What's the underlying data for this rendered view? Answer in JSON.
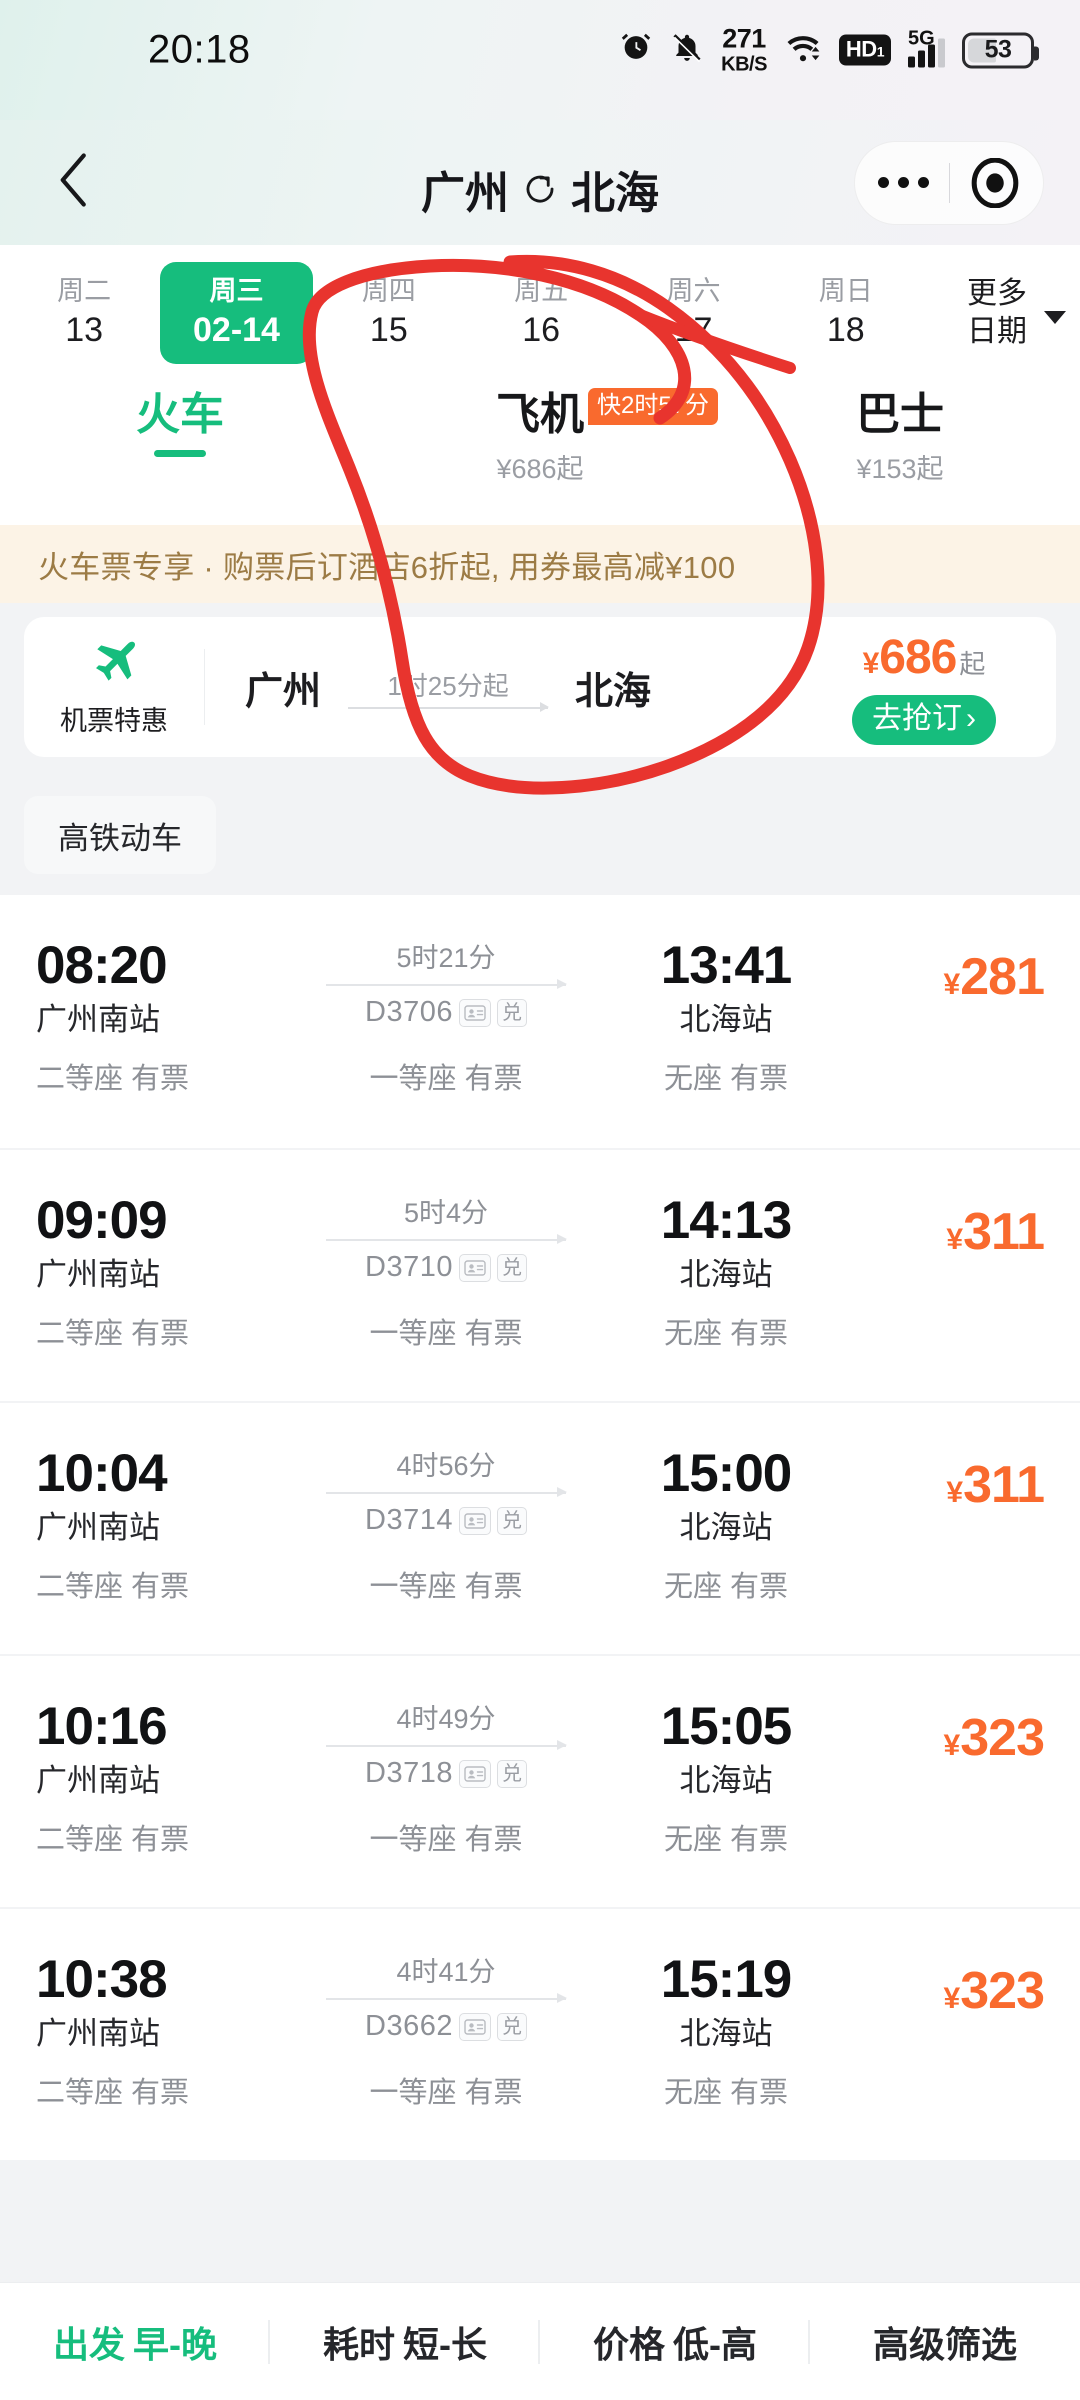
{
  "status_bar": {
    "time": "20:18",
    "alarm_icon": "alarm-icon",
    "mute_icon": "bell-muted-icon",
    "net_speed_value": "271",
    "net_speed_unit": "KB/S",
    "wifi_icon": "wifi-icon",
    "hd_label": "HD",
    "hd_sub": "1",
    "network_type": "5G",
    "battery_level": "53"
  },
  "nav": {
    "back_icon": "back-chevron-icon",
    "origin": "广州",
    "swap_icon": "swap-round-trip-icon",
    "destination": "北海",
    "capsule_more_icon": "more-dots-icon",
    "capsule_target_icon": "mini-program-close-icon"
  },
  "dates": {
    "items": [
      {
        "weekday": "周二",
        "day": "13",
        "active": false
      },
      {
        "weekday": "周三",
        "day": "02-14",
        "active": true
      },
      {
        "weekday": "周四",
        "day": "15",
        "active": false
      },
      {
        "weekday": "周五",
        "day": "16",
        "active": false
      },
      {
        "weekday": "周六",
        "day": "17",
        "active": false
      },
      {
        "weekday": "周日",
        "day": "18",
        "active": false
      }
    ],
    "more_line1": "更多",
    "more_line2": "日期"
  },
  "transport_tabs": [
    {
      "label": "火车",
      "sub": "",
      "badge": "",
      "active": true
    },
    {
      "label": "飞机",
      "sub": "¥686起",
      "badge": "快2时57分",
      "active": false
    },
    {
      "label": "巴士",
      "sub": "¥153起",
      "badge": "",
      "active": false
    }
  ],
  "ribbon": {
    "text": "火车票专享 · 购票后订酒店6折起, 用券最高减¥100"
  },
  "flight_promo": {
    "plane_icon": "airplane-icon",
    "tag": "机票特惠",
    "origin": "广州",
    "duration": "1时25分起",
    "destination": "北海",
    "currency": "¥",
    "price": "686",
    "price_suffix": "起",
    "cta": "去抢订",
    "cta_arrow": "›"
  },
  "filter_chips": [
    {
      "label": "高铁动车"
    }
  ],
  "trains": [
    {
      "depart_time": "08:20",
      "depart_station": "广州南站",
      "duration": "5时21分",
      "train_no": "D3706",
      "badge_id_icon": "id-card-icon",
      "badge_exchange": "兑",
      "arrive_time": "13:41",
      "arrive_station": "北海站",
      "currency": "¥",
      "price": "281",
      "seats": [
        "二等座 有票",
        "一等座 有票",
        "无座 有票"
      ]
    },
    {
      "depart_time": "09:09",
      "depart_station": "广州南站",
      "duration": "5时4分",
      "train_no": "D3710",
      "badge_id_icon": "id-card-icon",
      "badge_exchange": "兑",
      "arrive_time": "14:13",
      "arrive_station": "北海站",
      "currency": "¥",
      "price": "311",
      "seats": [
        "二等座 有票",
        "一等座 有票",
        "无座 有票"
      ]
    },
    {
      "depart_time": "10:04",
      "depart_station": "广州南站",
      "duration": "4时56分",
      "train_no": "D3714",
      "badge_id_icon": "id-card-icon",
      "badge_exchange": "兑",
      "arrive_time": "15:00",
      "arrive_station": "北海站",
      "currency": "¥",
      "price": "311",
      "seats": [
        "二等座 有票",
        "一等座 有票",
        "无座 有票"
      ]
    },
    {
      "depart_time": "10:16",
      "depart_station": "广州南站",
      "duration": "4时49分",
      "train_no": "D3718",
      "badge_id_icon": "id-card-icon",
      "badge_exchange": "兑",
      "arrive_time": "15:05",
      "arrive_station": "北海站",
      "currency": "¥",
      "price": "323",
      "seats": [
        "二等座 有票",
        "一等座 有票",
        "无座 有票"
      ]
    },
    {
      "depart_time": "10:38",
      "depart_station": "广州南站",
      "duration": "4时41分",
      "train_no": "D3662",
      "badge_id_icon": "id-card-icon",
      "badge_exchange": "兑",
      "arrive_time": "15:19",
      "arrive_station": "北海站",
      "currency": "¥",
      "price": "323",
      "seats": [
        "二等座 有票",
        "一等座 有票",
        "无座 有票"
      ]
    }
  ],
  "bottom_bar": [
    {
      "key": "出发",
      "opt": "早-晚",
      "active": true
    },
    {
      "key": "耗时",
      "opt": "短-长",
      "active": false
    },
    {
      "key": "价格",
      "opt": "低-高",
      "active": false
    },
    {
      "key": "高级筛选",
      "opt": "",
      "active": false
    }
  ],
  "annotation": {
    "type": "hand-drawn-circle",
    "color": "#e8342e",
    "target": "飞机"
  },
  "colors": {
    "brand_green": "#16bd7d",
    "price_orange": "#f96a2e",
    "badge_orange": "#f96a2e",
    "ribbon_bg": "#fcf3e6",
    "ribbon_text": "#9c7b45",
    "annotation_red": "#e8342e"
  }
}
